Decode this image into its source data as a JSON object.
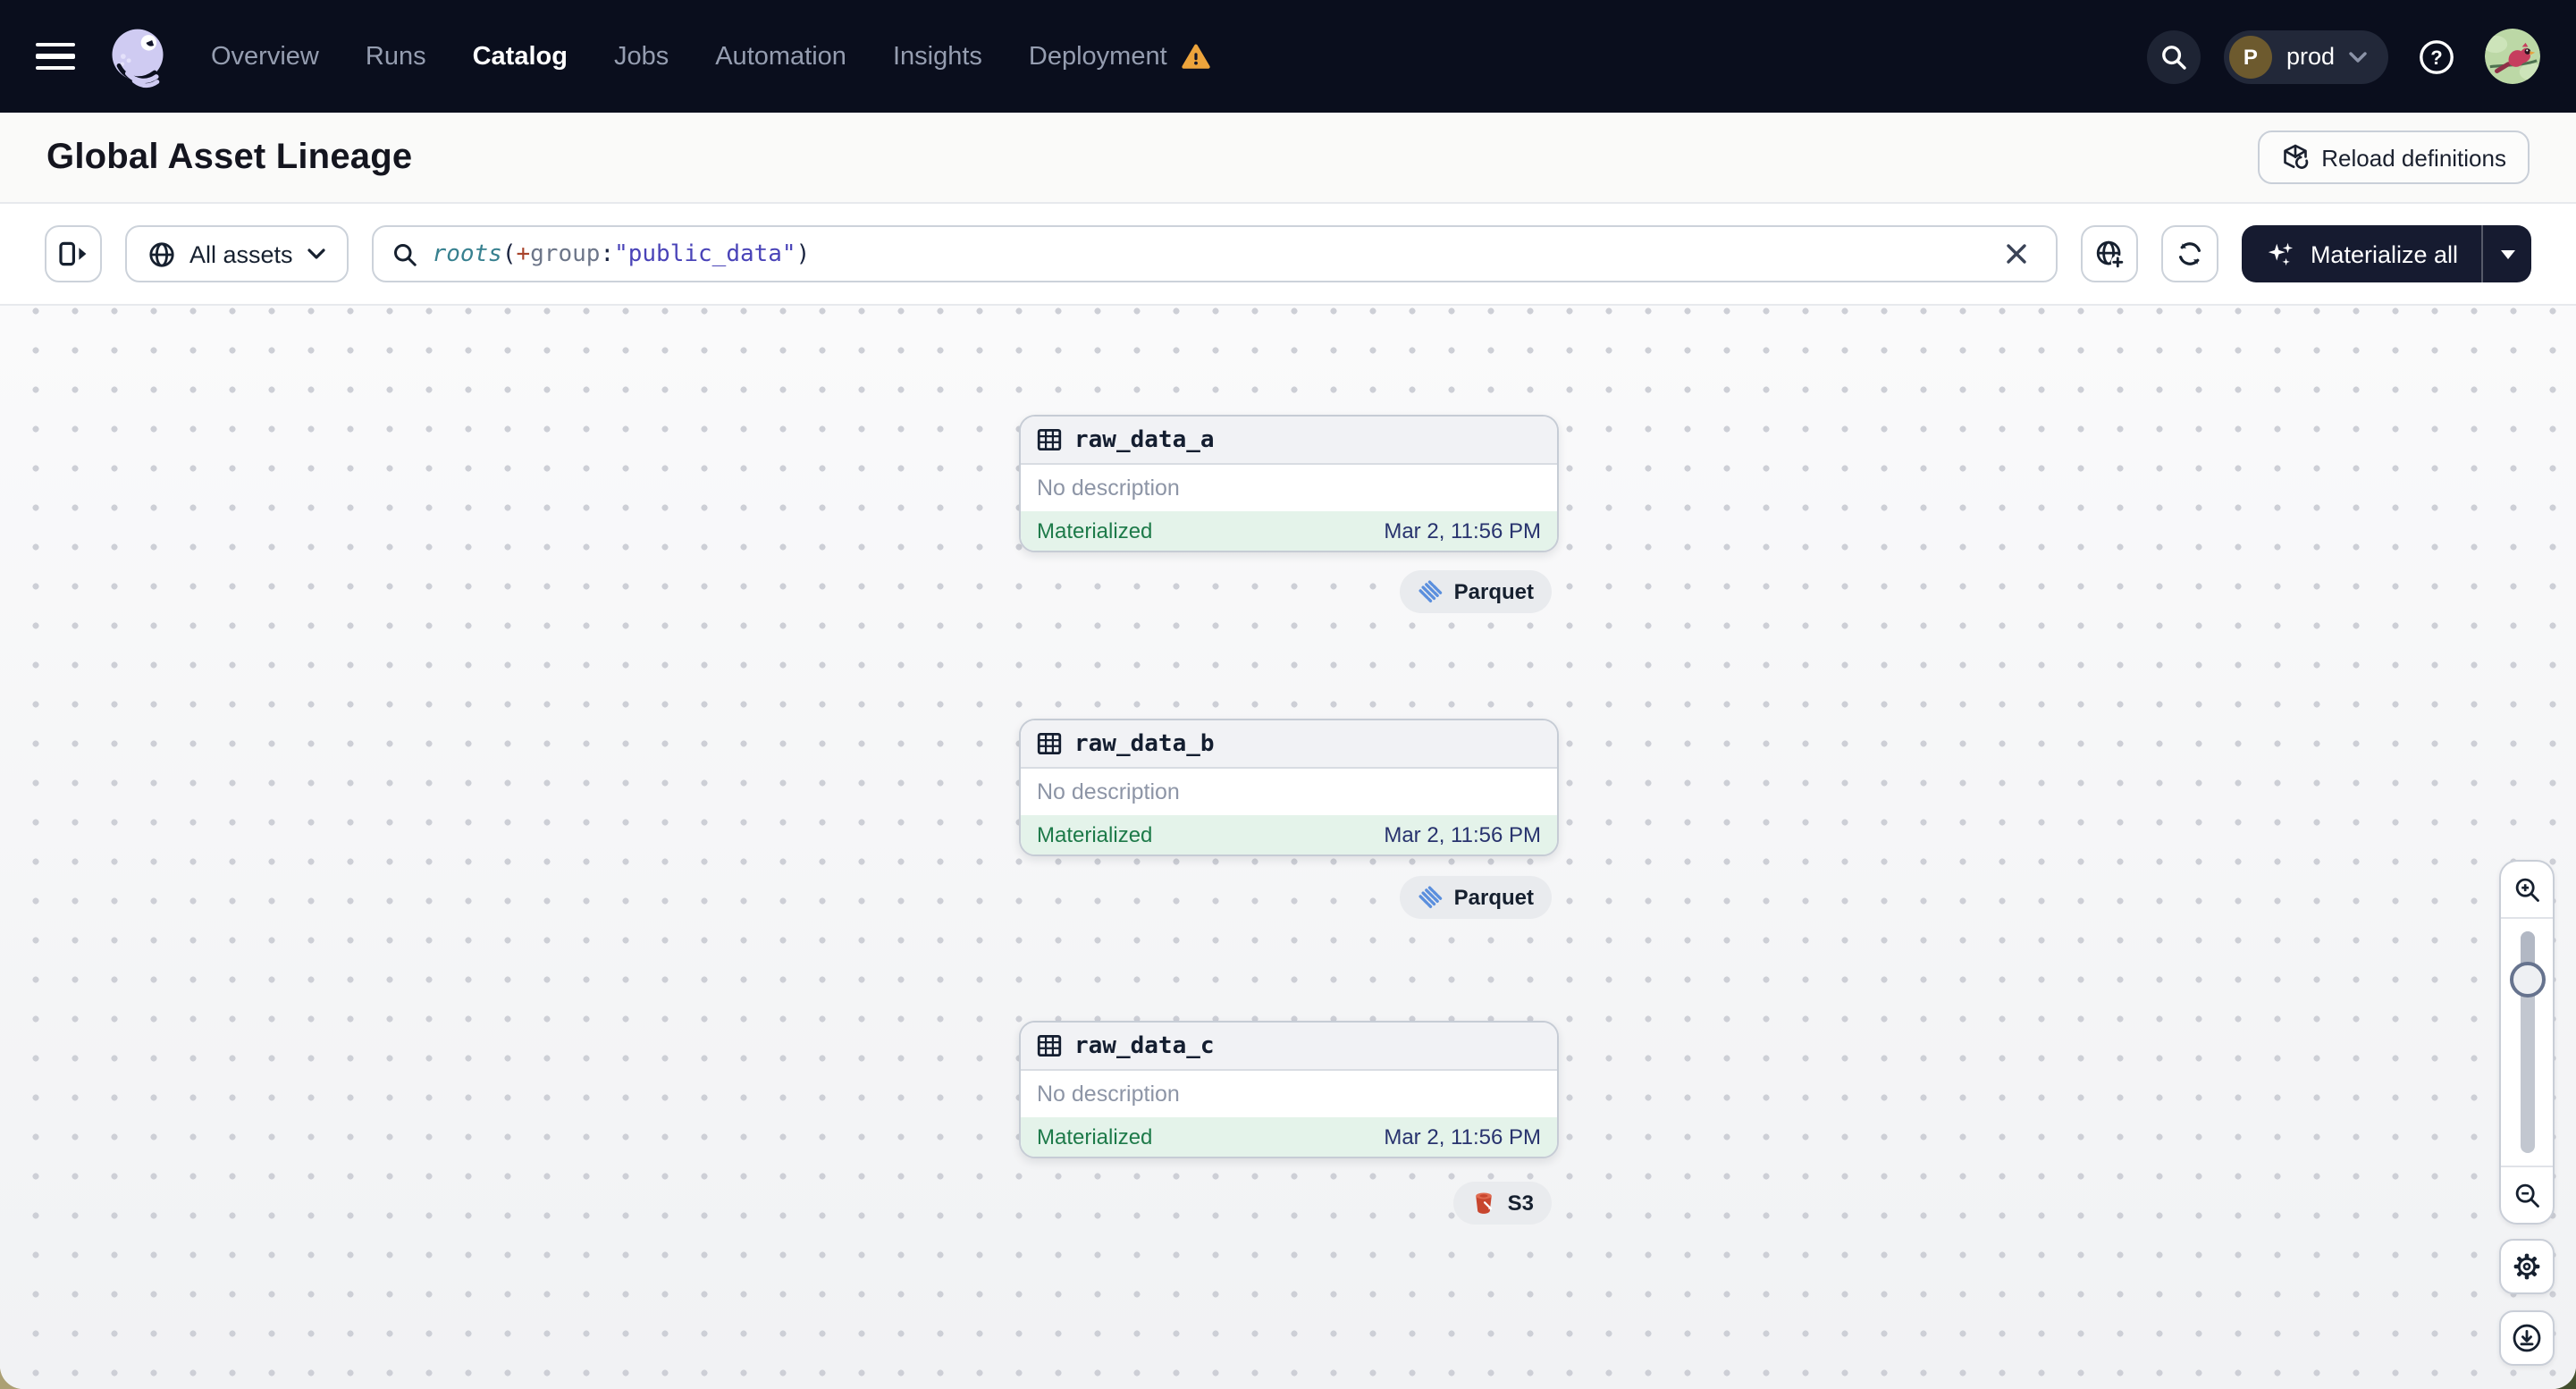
{
  "nav": {
    "items": [
      {
        "label": "Overview",
        "active": false
      },
      {
        "label": "Runs",
        "active": false
      },
      {
        "label": "Catalog",
        "active": true
      },
      {
        "label": "Jobs",
        "active": false
      },
      {
        "label": "Automation",
        "active": false
      },
      {
        "label": "Insights",
        "active": false
      },
      {
        "label": "Deployment",
        "active": false,
        "warning": true
      }
    ],
    "env": {
      "initial": "P",
      "name": "prod"
    },
    "help_glyph": "?"
  },
  "header": {
    "title": "Global Asset Lineage",
    "reload_button": "Reload definitions"
  },
  "toolbar": {
    "filter_label": "All assets",
    "search": {
      "fn": "roots",
      "open": "(",
      "op": "+",
      "field": "group",
      "colon": ":",
      "value": "\"public_data\"",
      "close": ")"
    },
    "materialize_label": "Materialize all"
  },
  "canvas": {
    "nodes": [
      {
        "name": "raw_data_a",
        "description": "No description",
        "status": "Materialized",
        "timestamp": "Mar 2, 11:56 PM",
        "tag": "Parquet"
      },
      {
        "name": "raw_data_b",
        "description": "No description",
        "status": "Materialized",
        "timestamp": "Mar 2, 11:56 PM",
        "tag": "Parquet"
      },
      {
        "name": "raw_data_c",
        "description": "No description",
        "status": "Materialized",
        "timestamp": "Mar 2, 11:56 PM",
        "tag": "S3"
      }
    ]
  },
  "colors": {
    "nav_background": "#0a0e1d",
    "materialized_green": "#1d7a49",
    "timestamp_navy": "#28336e",
    "warning_orange": "#eda43c",
    "parquet_blue": "#5b8fdd",
    "s3_red": "#c8462e",
    "query_function_teal": "#37808f",
    "query_string_indigo": "#4a44b8"
  }
}
